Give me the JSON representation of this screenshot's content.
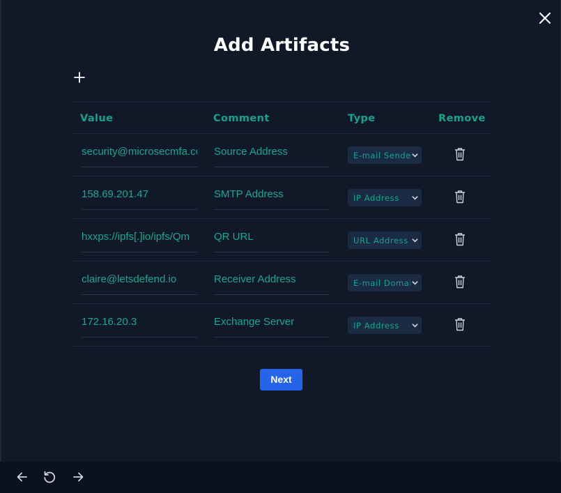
{
  "modal": {
    "title": "Add Artifacts",
    "next_label": "Next"
  },
  "table": {
    "headers": {
      "value": "Value",
      "comment": "Comment",
      "type": "Type",
      "remove": "Remove"
    },
    "rows": [
      {
        "value": "security@microsecmfa.com",
        "comment": "Source Address",
        "type": "E-mail Sender"
      },
      {
        "value": "158.69.201.47",
        "comment": "SMTP Address",
        "type": "IP Address"
      },
      {
        "value": "hxxps://ipfs[.]io/ipfs/Qm",
        "comment": "QR URL",
        "type": "URL Address"
      },
      {
        "value": "claire@letsdefend.io",
        "comment": "Receiver Address",
        "type": "E-mail Domain"
      },
      {
        "value": "172.16.20.3",
        "comment": "Exchange Server",
        "type": "IP Address"
      }
    ]
  },
  "icons": {
    "close": "close-icon",
    "add": "plus-icon",
    "remove": "trash-icon",
    "dropdown": "chevron-down-icon",
    "back": "arrow-left-icon",
    "reload": "reload-icon",
    "forward": "arrow-right-icon"
  },
  "colors": {
    "background": "#111827",
    "accent": "#14a38b",
    "button": "#2563eb"
  }
}
